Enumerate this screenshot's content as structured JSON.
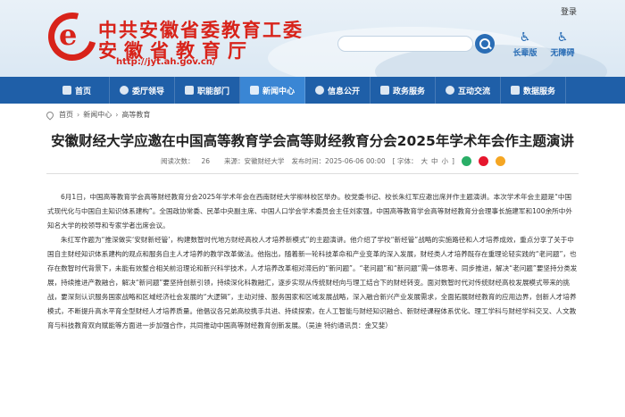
{
  "header": {
    "title_line1": "中共安徽省委教育工委",
    "title_line2": "安徽省教育厅",
    "url": "http://jyt.ah.gov.cn/",
    "login": "登录",
    "accessibility": [
      {
        "label": "长辈版",
        "icon": "elder-icon"
      },
      {
        "label": "无障碍",
        "icon": "accessibility-icon"
      }
    ]
  },
  "nav": {
    "items": [
      {
        "label": "首页",
        "icon": "home-icon"
      },
      {
        "label": "委厅领导",
        "icon": "leader-icon"
      },
      {
        "label": "职能部门",
        "icon": "department-icon"
      },
      {
        "label": "新闻中心",
        "icon": "news-icon",
        "active": true
      },
      {
        "label": "信息公开",
        "icon": "info-icon"
      },
      {
        "label": "政务服务",
        "icon": "service-icon"
      },
      {
        "label": "互动交流",
        "icon": "interact-icon"
      },
      {
        "label": "数据服务",
        "icon": "data-icon"
      }
    ]
  },
  "breadcrumb": [
    "首页",
    "新闻中心",
    "高等教育"
  ],
  "article": {
    "title": "安徽财经大学应邀在中国高等教育学会高等财经教育分会2025年学术年会作主题演讲",
    "views_label": "阅读次数：",
    "views": "26",
    "source": "来源：安徽财经大学",
    "date": "发布时间：2025-06-06 00:00",
    "font_label": "[ 字体：",
    "font_sizes": [
      "大",
      "中",
      "小"
    ],
    "font_close": "]",
    "paragraphs": [
      "6月1日，中国高等教育学会高等财经教育分会2025年学术年会在西南财经大学柳林校区举办。校党委书记、校长朱红军应邀出席并作主题演讲。本次学术年会主题是“中国式现代化与中国自主知识体系建构”。全国政协常委、民革中央副主席、中国人口学会学术委员会主任刘家强，中国高等教育学会高等财经教育分会理事长施建军和100余所中外知名大学的校领导和专家学者出席会议。",
      "朱红军作题为“推深做实‘安财新经管’，构建数智时代地方财经高校人才培养新模式”的主题演讲。他介绍了学校“新经管”战略的实施路径和人才培养成效，重点分享了关于中国自主财经知识体系建构的观点和服务自主人才培养的教学改革做法。他指出，随着新一轮科技革命和产业变革的深入发展，财经类人才培养既存在重理论轻实践的“老问题”，也存在数智时代背景下，未能有效整合相关前沿理论和新兴科学技术，人才培养改革相对滞后的“新问题”。“老问题”和“新问题”需一体思考、同步推进，解决“老问题”要坚持分类发展，持续推进产教融合，解决“新问题”要坚持创新引领，持续深化科教融汇，逐步实现从传统财经向与理工结合下的财经转变。面对数智时代对传统财经高校发展模式带来的挑战，要深刻认识服务国家战略和区域经济社会发展的“大逻辑”，主动对接、服务国家和区域发展战略，深入融合新兴产业发展需求，全面拓展财经教育的应用边界，创新人才培养模式，不断提升高水平育全型财经人才培养质量。他倡议各兄弟高校携手共进、持续探索，在人工智能与财经知识融合、新财经课程体系优化、理工学科与财经学科交叉、人文教育与科技教育双向赋能等方面进一步加强合作，共同推动中国高等财经教育创新发展。（吴迪 特约通讯员：金又斐）"
    ]
  },
  "colors": {
    "brand_red": "#d8231a",
    "nav_blue": "#1f5fa8",
    "nav_active": "#3a86d4",
    "share_wechat": "#2aae67",
    "share_weibo": "#e6162d",
    "share_qzone": "#f5a623"
  }
}
